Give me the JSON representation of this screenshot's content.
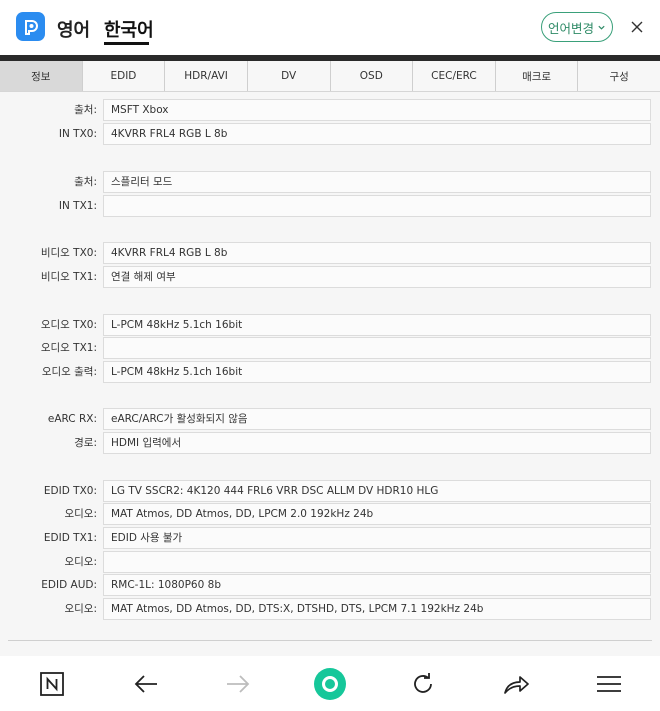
{
  "translator": {
    "source_lang": "영어",
    "target_lang": "한국어",
    "change_button": "언어변경"
  },
  "tabs": [
    {
      "label": "정보",
      "active": true
    },
    {
      "label": "EDID",
      "active": false
    },
    {
      "label": "HDR/AVI",
      "active": false
    },
    {
      "label": "DV",
      "active": false
    },
    {
      "label": "OSD",
      "active": false
    },
    {
      "label": "CEC/ERC",
      "active": false
    },
    {
      "label": "매크로",
      "active": false
    },
    {
      "label": "구성",
      "active": false
    }
  ],
  "rows": [
    {
      "label": "출처:",
      "value": "MSFT Xbox"
    },
    {
      "label": "IN TX0:",
      "value": "4KVRR FRL4 RGB L 8b"
    },
    {
      "label": "출처:",
      "value": "스플리터 모드"
    },
    {
      "label": "IN TX1:",
      "value": ""
    },
    {
      "label": "비디오 TX0:",
      "value": "4KVRR FRL4 RGB L 8b"
    },
    {
      "label": "비디오 TX1:",
      "value": "연결 해제 여부"
    },
    {
      "label": "오디오 TX0:",
      "value": "L-PCM 48kHz 5.1ch 16bit"
    },
    {
      "label": "오디오 TX1:",
      "value": ""
    },
    {
      "label": "오디오 출력:",
      "value": "L-PCM 48kHz 5.1ch 16bit"
    },
    {
      "label": "eARC RX:",
      "value": "eARC/ARC가 활성화되지 않음"
    },
    {
      "label": "경로:",
      "value": "HDMI 입력에서"
    },
    {
      "label": "EDID TX0:",
      "value": "LG TV SSCR2: 4K120 444 FRL6 VRR DSC ALLM DV HDR10 HLG"
    },
    {
      "label": "오디오:",
      "value": "MAT Atmos, DD Atmos, DD, LPCM 2.0 192kHz 24b"
    },
    {
      "label": "EDID TX1:",
      "value": "EDID 사용 불가"
    },
    {
      "label": "오디오:",
      "value": ""
    },
    {
      "label": "EDID AUD:",
      "value": "RMC-1L: 1080P60 8b"
    },
    {
      "label": "오디오:",
      "value": "MAT Atmos, DD Atmos, DD, DTS:X, DTSHD, DTS, LPCM 7.1 192kHz 24b"
    }
  ],
  "colors": {
    "accent_green": "#16c79a",
    "app_logo_blue": "#2b8cf0",
    "active_tab_bg": "#d9d9d9"
  },
  "icons": {
    "app_logo": "papago-logo-icon",
    "close": "close-icon",
    "bottom_nav": [
      "n-square-icon",
      "back-arrow-icon",
      "forward-arrow-icon",
      "home-circle-icon",
      "reload-icon",
      "share-icon",
      "menu-icon"
    ]
  }
}
